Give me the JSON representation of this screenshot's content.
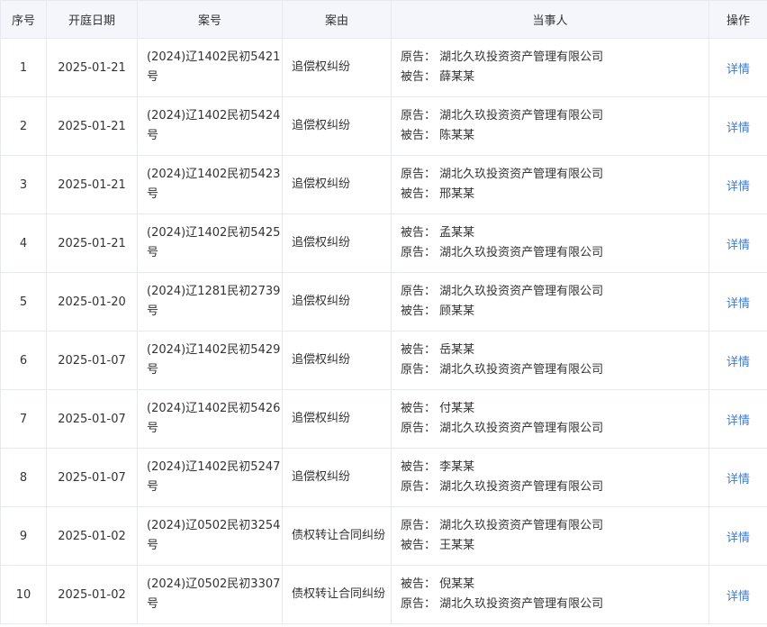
{
  "headers": {
    "index": "序号",
    "date": "开庭日期",
    "case_no": "案号",
    "cause": "案由",
    "parties": "当事人",
    "action": "操作"
  },
  "rows": [
    {
      "index": "1",
      "date": "2025-01-21",
      "case_no": "(2024)辽1402民初5421号",
      "cause": "追偿权纠纷",
      "party1": "原告：  湖北久玖投资资产管理有限公司",
      "party2": "被告：  薛某某",
      "action": "详情"
    },
    {
      "index": "2",
      "date": "2025-01-21",
      "case_no": "(2024)辽1402民初5424号",
      "cause": "追偿权纠纷",
      "party1": "原告：  湖北久玖投资资产管理有限公司",
      "party2": "被告：  陈某某",
      "action": "详情"
    },
    {
      "index": "3",
      "date": "2025-01-21",
      "case_no": "(2024)辽1402民初5423号",
      "cause": "追偿权纠纷",
      "party1": "原告：  湖北久玖投资资产管理有限公司",
      "party2": "被告：  邢某某",
      "action": "详情"
    },
    {
      "index": "4",
      "date": "2025-01-21",
      "case_no": "(2024)辽1402民初5425号",
      "cause": "追偿权纠纷",
      "party1": "被告：  孟某某",
      "party2": "原告：  湖北久玖投资资产管理有限公司",
      "action": "详情"
    },
    {
      "index": "5",
      "date": "2025-01-20",
      "case_no": "(2024)辽1281民初2739号",
      "cause": "追偿权纠纷",
      "party1": "原告：  湖北久玖投资资产管理有限公司",
      "party2": "被告：  顾某某",
      "action": "详情"
    },
    {
      "index": "6",
      "date": "2025-01-07",
      "case_no": "(2024)辽1402民初5429号",
      "cause": "追偿权纠纷",
      "party1": "被告：  岳某某",
      "party2": "原告：  湖北久玖投资资产管理有限公司",
      "action": "详情"
    },
    {
      "index": "7",
      "date": "2025-01-07",
      "case_no": "(2024)辽1402民初5426号",
      "cause": "追偿权纠纷",
      "party1": "被告：  付某某",
      "party2": "原告：  湖北久玖投资资产管理有限公司",
      "action": "详情"
    },
    {
      "index": "8",
      "date": "2025-01-07",
      "case_no": "(2024)辽1402民初5247号",
      "cause": "追偿权纠纷",
      "party1": "被告：  李某某",
      "party2": "原告：  湖北久玖投资资产管理有限公司",
      "action": "详情"
    },
    {
      "index": "9",
      "date": "2025-01-02",
      "case_no": "(2024)辽0502民初3254号",
      "cause": "债权转让合同纠纷",
      "party1": "原告：  湖北久玖投资资产管理有限公司",
      "party2": "被告：  王某某",
      "action": "详情"
    },
    {
      "index": "10",
      "date": "2025-01-02",
      "case_no": "(2024)辽0502民初3307号",
      "cause": "债权转让合同纠纷",
      "party1": "被告：  倪某某",
      "party2": "原告：  湖北久玖投资资产管理有限公司",
      "action": "详情"
    }
  ]
}
